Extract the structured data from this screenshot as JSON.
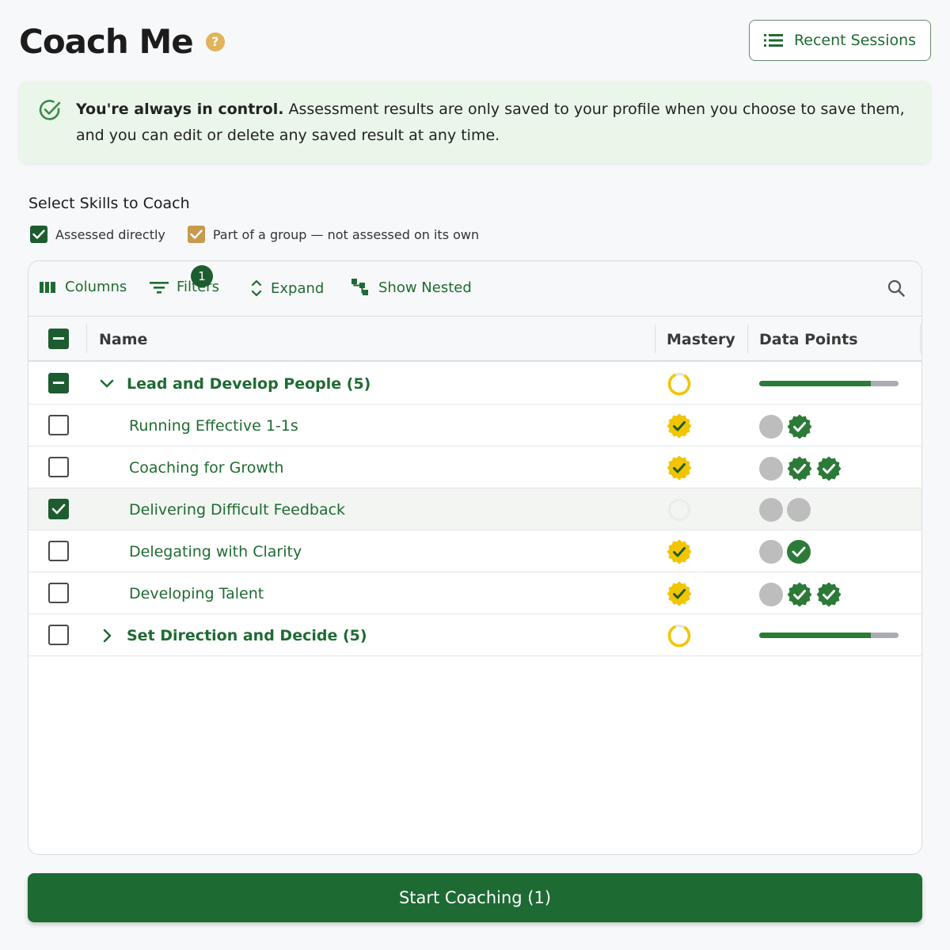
{
  "header": {
    "title": "Coach Me",
    "help_icon": "question-circle-icon",
    "recent_sessions_label": "Recent Sessions"
  },
  "banner": {
    "bold_text": "You're always in control.",
    "text": " Assessment results are only saved to your profile when you choose to save them, and you can edit or delete any saved result at any time."
  },
  "section": {
    "title": "Select Skills to Coach",
    "legend": [
      {
        "label": "Assessed directly",
        "color": "#1d5c30"
      },
      {
        "label": "Part of a group — not assessed on its own",
        "color": "#c99a4e"
      }
    ]
  },
  "toolbar": {
    "columns_label": "Columns",
    "filters_label": "Filters",
    "filters_count": "1",
    "expand_label": "Expand",
    "show_nested_label": "Show Nested"
  },
  "table": {
    "columns": {
      "name": "Name",
      "mastery": "Mastery",
      "data_points": "Data Points"
    },
    "rows": [
      {
        "name": "Lead and Develop People (5)",
        "type": "group",
        "expanded": true,
        "checkbox": "partial",
        "mastery": "ring-partial",
        "progress": 0.8
      },
      {
        "name": "Running Effective 1-1s",
        "type": "child",
        "checkbox": "unchecked",
        "mastery": "badge",
        "points": [
          "grey",
          "badge"
        ]
      },
      {
        "name": "Coaching for Growth",
        "type": "child",
        "checkbox": "unchecked",
        "mastery": "badge",
        "points": [
          "grey",
          "badge",
          "badge"
        ]
      },
      {
        "name": "Delivering Difficult Feedback",
        "type": "child",
        "checkbox": "checked",
        "selected": true,
        "mastery": "empty",
        "points": [
          "grey",
          "grey"
        ]
      },
      {
        "name": "Delegating with Clarity",
        "type": "child",
        "checkbox": "unchecked",
        "mastery": "badge",
        "points": [
          "grey",
          "check"
        ]
      },
      {
        "name": "Developing Talent",
        "type": "child",
        "checkbox": "unchecked",
        "mastery": "badge",
        "points": [
          "grey",
          "badge",
          "badge"
        ]
      },
      {
        "name": "Set Direction and Decide (5)",
        "type": "group",
        "expanded": false,
        "checkbox": "unchecked",
        "mastery": "ring-partial",
        "progress": 0.8
      }
    ]
  },
  "footer": {
    "start_label": "Start Coaching (1)"
  },
  "colors": {
    "brand_green": "#1d6a33",
    "accent_gold": "#f2c500",
    "banner_bg": "#eaf6ea"
  }
}
